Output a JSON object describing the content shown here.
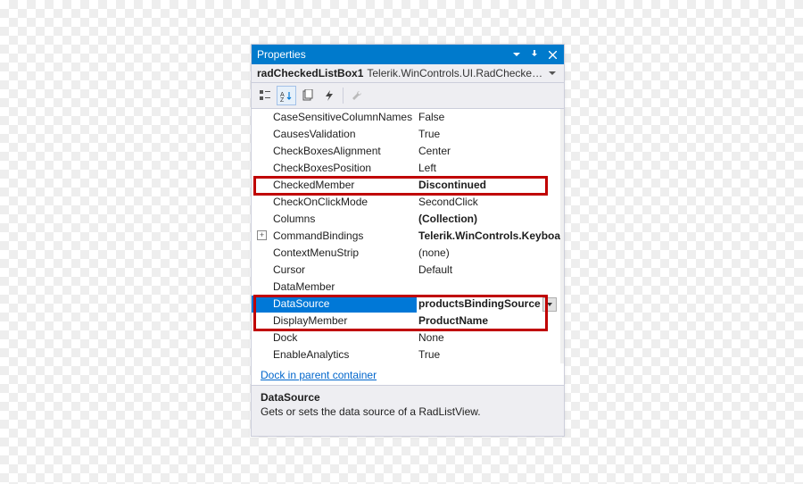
{
  "titlebar": {
    "title": "Properties"
  },
  "object": {
    "name": "radCheckedListBox1",
    "type": "Telerik.WinControls.UI.RadCheckedListBox"
  },
  "toolbar": {
    "categorized": "categorized-icon",
    "alphabetical": "alphabetical-icon",
    "property_pages": "property-pages-icon",
    "events": "events-icon",
    "wrench": "wrench-icon"
  },
  "rows": [
    {
      "name": "CaseSensitiveColumnNames",
      "value": "False"
    },
    {
      "name": "CausesValidation",
      "value": "True"
    },
    {
      "name": "CheckBoxesAlignment",
      "value": "Center"
    },
    {
      "name": "CheckBoxesPosition",
      "value": "Left"
    },
    {
      "name": "CheckedMember",
      "value": "Discontinued",
      "bold": true
    },
    {
      "name": "CheckOnClickMode",
      "value": "SecondClick"
    },
    {
      "name": "Columns",
      "value": "(Collection)",
      "bold": true
    },
    {
      "name": "CommandBindings",
      "value": "Telerik.WinControls.Keyboa",
      "bold": true,
      "expandable": true
    },
    {
      "name": "ContextMenuStrip",
      "value": "(none)"
    },
    {
      "name": "Cursor",
      "value": "Default"
    },
    {
      "name": "DataMember",
      "value": ""
    },
    {
      "name": "DataSource",
      "value": "productsBindingSource",
      "bold": true,
      "selected": true,
      "dropdown": true
    },
    {
      "name": "DisplayMember",
      "value": "ProductName",
      "bold": true
    },
    {
      "name": "Dock",
      "value": "None"
    },
    {
      "name": "EnableAnalytics",
      "value": "True"
    }
  ],
  "footerLink": {
    "text": "Dock in parent container"
  },
  "description": {
    "title": "DataSource",
    "text": "Gets or sets the data source of a RadListView."
  }
}
